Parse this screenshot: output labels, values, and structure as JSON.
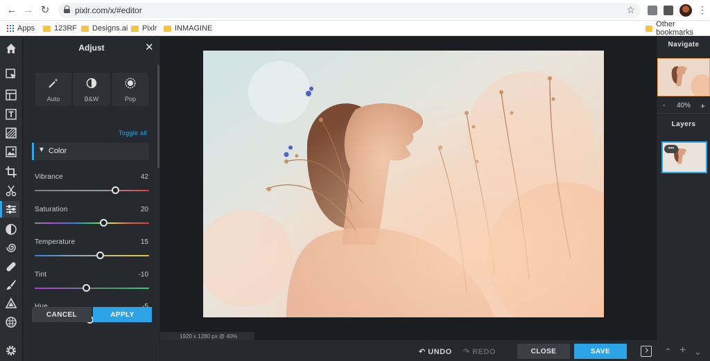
{
  "browser": {
    "url": "pixlr.com/x/#editor",
    "bookmarks": [
      "Apps",
      "123RF",
      "Designs.ai",
      "Pixlr",
      "INMAGINE"
    ],
    "other_bookmarks": "Other bookmarks"
  },
  "tools": [
    "home-icon",
    "select-icon",
    "layout-icon",
    "text-icon",
    "hatch-icon",
    "image-icon",
    "crop-icon",
    "cutout-icon",
    "adjust-icon",
    "filter-icon",
    "liquify-icon",
    "heal-icon",
    "brush-icon",
    "shape-icon",
    "pattern-icon",
    "settings-icon"
  ],
  "adjust": {
    "title": "Adjust",
    "quick": [
      {
        "label": "Auto",
        "icon": "magic-wand-icon"
      },
      {
        "label": "B&W",
        "icon": "contrast-icon"
      },
      {
        "label": "Pop",
        "icon": "pop-icon"
      }
    ],
    "toggle_all": "Toggle all",
    "section": "Color",
    "sliders": [
      {
        "label": "Vibrance",
        "value": "42",
        "fraction": 0.7
      },
      {
        "label": "Saturation",
        "value": "20",
        "fraction": 0.6
      },
      {
        "label": "Temperature",
        "value": "15",
        "fraction": 0.57
      },
      {
        "label": "Tint",
        "value": "-10",
        "fraction": 0.45
      },
      {
        "label": "Hue",
        "value": "-5",
        "fraction": 0.48
      }
    ],
    "cancel": "CANCEL",
    "apply": "APPLY"
  },
  "status": "1920 x 1280 px @ 40%",
  "bottom": {
    "undo": "UNDO",
    "redo": "REDO",
    "close": "CLOSE",
    "save": "SAVE"
  },
  "navigate": {
    "title": "Navigate",
    "zoom": "40%",
    "minus": "-",
    "plus": "+"
  },
  "layers": {
    "title": "Layers"
  },
  "colors": {
    "accent": "#2ba3e6",
    "panel": "#26292e",
    "toolbar": "#2a2d31"
  }
}
